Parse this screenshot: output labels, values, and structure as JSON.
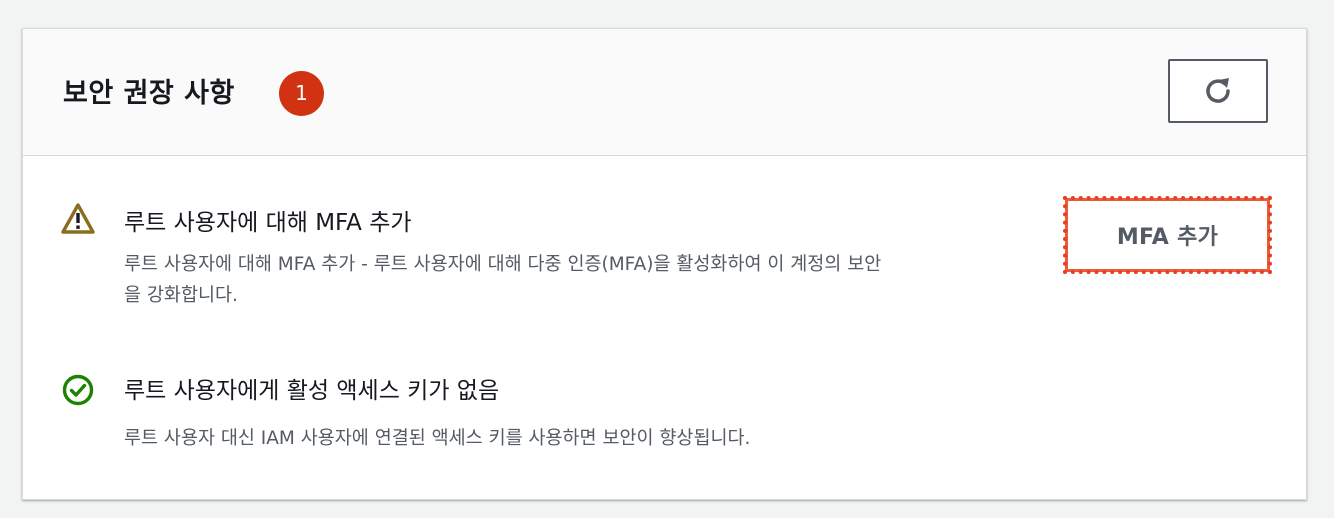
{
  "panel": {
    "title": "보안 권장 사항",
    "badge_count": "1",
    "refresh_icon": "refresh-icon"
  },
  "recommendations": [
    {
      "status": "warning",
      "icon": "warning-icon",
      "title": "루트 사용자에 대해 MFA 추가",
      "description_line1": "루트 사용자에 대해 MFA 추가 - 루트 사용자에 대해 다중 인증(MFA)을 활성화하여 이 계정의 보안",
      "description_line2": "을 강화합니다.",
      "action_label": "MFA 추가"
    },
    {
      "status": "ok",
      "icon": "check-circle-icon",
      "title": "루트 사용자에게 활성 액세스 키가 없음",
      "description_line1": "루트 사용자 대신 IAM 사용자에 연결된 액세스 키를 사용하면 보안이 향상됩니다."
    }
  ],
  "colors": {
    "badge": "#d13212",
    "warning": "#8a6d1f",
    "success": "#1d8102",
    "highlight": "#e8401c"
  }
}
